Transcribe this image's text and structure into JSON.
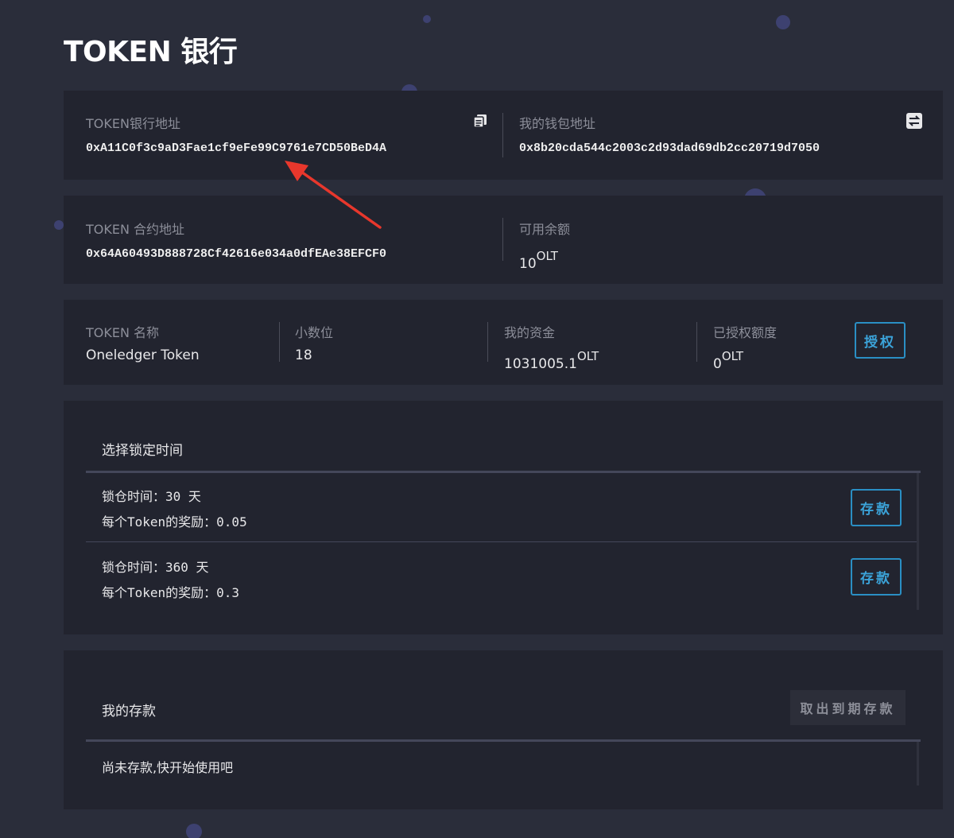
{
  "title": "TOKEN 银行",
  "bank_address": {
    "label": "TOKEN银行地址",
    "value": "0xA11C0f3c9aD3Fae1cf9eFe99C9761e7CD50BeD4A",
    "icon": "copy-icon"
  },
  "wallet_address": {
    "label": "我的钱包地址",
    "value": "0x8b20cda544c2003c2d93dad69db2cc20719d7050",
    "icon": "swap-icon"
  },
  "contract_address": {
    "label": "TOKEN 合约地址",
    "value": "0x64A60493D888728Cf42616e034a0dfEAe38EFCF0"
  },
  "available_balance": {
    "label": "可用余额",
    "value": "10",
    "unit": "OLT"
  },
  "token_info": {
    "name_label": "TOKEN 名称",
    "name_value": "Oneledger Token",
    "decimals_label": "小数位",
    "decimals_value": "18",
    "funds_label": "我的资金",
    "funds_value": "1031005.1",
    "funds_unit": "OLT",
    "approved_label": "已授权额度",
    "approved_value": "0",
    "approved_unit": "OLT",
    "authorize_button": "授权"
  },
  "lock": {
    "title": "选择锁定时间",
    "options": [
      {
        "period": "锁仓时间：30 天",
        "reward": "每个Token的奖励：0.05",
        "button": "存款"
      },
      {
        "period": "锁仓时间：360 天",
        "reward": "每个Token的奖励：0.3",
        "button": "存款"
      }
    ]
  },
  "deposits": {
    "title": "我的存款",
    "withdraw_button": "取出到期存款",
    "empty_message": "尚未存款,快开始使用吧"
  },
  "colors": {
    "background": "#2a2d3a",
    "card": "#22242f",
    "accent": "#3ba3d9",
    "annotation_arrow": "#e8372c"
  }
}
